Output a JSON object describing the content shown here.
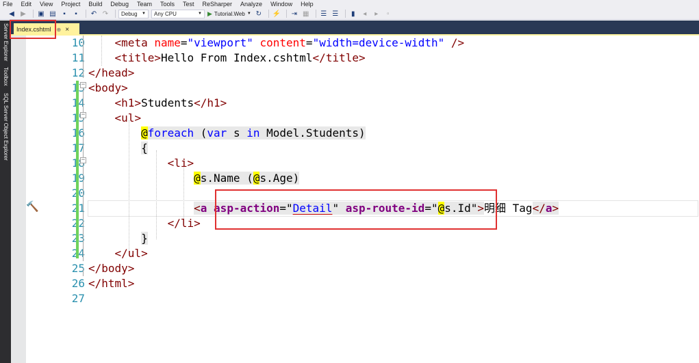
{
  "menu": [
    "File",
    "Edit",
    "View",
    "Project",
    "Build",
    "Debug",
    "Team",
    "Tools",
    "Test",
    "ReSharper",
    "Analyze",
    "Window",
    "Help"
  ],
  "toolbar": {
    "config": "Debug",
    "platform": "Any CPU",
    "run_target": "Tutorial.Web"
  },
  "side_tabs": [
    "Server Explorer",
    "Toolbox",
    "SQL Server Object Explorer"
  ],
  "tab": {
    "label": "Index.cshtml",
    "pin": "⊕",
    "close": "×"
  },
  "line_numbers": [
    "10",
    "11",
    "12",
    "13",
    "14",
    "15",
    "16",
    "17",
    "18",
    "19",
    "20",
    "21",
    "22",
    "23",
    "24",
    "25",
    "26",
    "27"
  ],
  "code": {
    "l10_tag": "meta",
    "l10_a1": "name",
    "l10_v1": "\"viewport\"",
    "l10_a2": "content",
    "l10_v2": "\"width=device-width\"",
    "l11_tag": "title",
    "l11_txt": "Hello From Index.cshtml",
    "l12_tag": "head",
    "l13_tag": "body",
    "l14_tag": "h1",
    "l14_txt": "Students",
    "l15_tag": "ul",
    "l16_at": "@",
    "l16_kw1": "foreach",
    "l16_p1": " (",
    "l16_kw2": "var",
    "l16_p2": " s ",
    "l16_kw3": "in",
    "l16_p3": " Model.Students)",
    "l17": "{",
    "l18_tag": "li",
    "l19_at1": "@",
    "l19_t1": "s.Name (",
    "l19_at2": "@",
    "l19_t2": "s.Age)",
    "l21_tag": "a",
    "l21_a1": "asp-action",
    "l21_v1": "Detail",
    "l21_a2": "asp-route-id",
    "l21_at": "@",
    "l21_t": "s.Id",
    "l21_txt": "明细 Tag",
    "l22_tag": "li",
    "l23": "}",
    "l24_tag": "ul",
    "l25_tag": "body",
    "l26_tag": "html"
  }
}
